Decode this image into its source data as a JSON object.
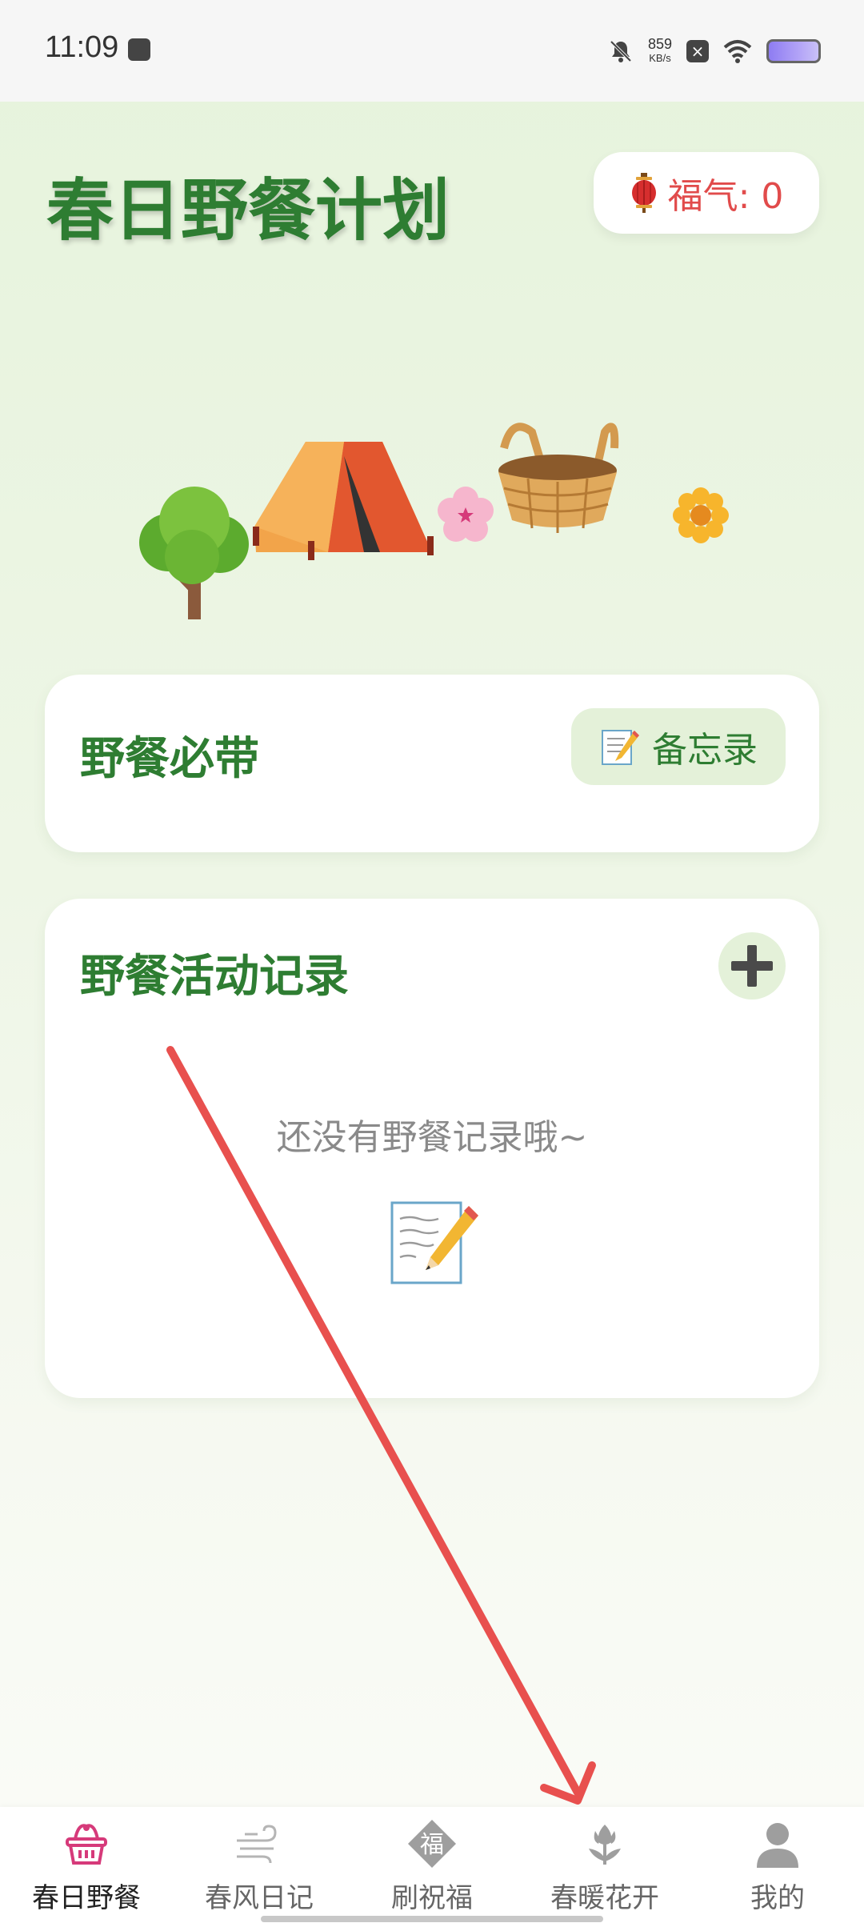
{
  "status_bar": {
    "time": "11:09",
    "network_speed": "859",
    "network_unit": "KB/s"
  },
  "header": {
    "title": "春日野餐计划",
    "fortune_label": "福气: 0"
  },
  "card_essentials": {
    "title": "野餐必带",
    "memo_button_label": "备忘录"
  },
  "card_records": {
    "title": "野餐活动记录",
    "empty_text": "还没有野餐记录哦~"
  },
  "bottom_nav": {
    "items": [
      {
        "label": "春日野餐",
        "icon": "basket-icon",
        "active": true
      },
      {
        "label": "春风日记",
        "icon": "wind-icon",
        "active": false
      },
      {
        "label": "刷祝福",
        "icon": "fu-blessing-icon",
        "active": false
      },
      {
        "label": "春暖花开",
        "icon": "tulip-icon",
        "active": false
      },
      {
        "label": "我的",
        "icon": "person-icon",
        "active": false
      }
    ]
  },
  "colors": {
    "accent_green": "#2e7d32",
    "fortune_red": "#e14b4b",
    "active_nav": "#d63a7a",
    "annotation_arrow": "#e8504e"
  }
}
